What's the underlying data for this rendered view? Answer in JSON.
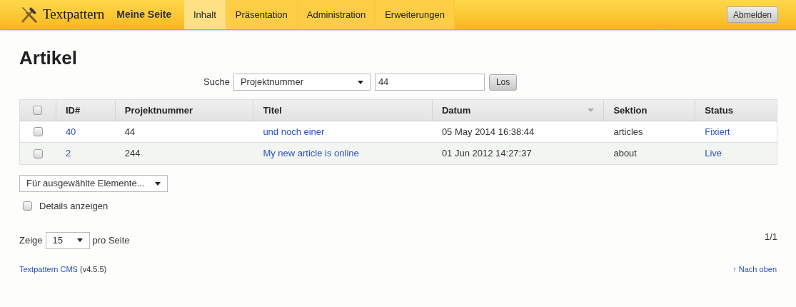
{
  "header": {
    "brand": "Textpattern",
    "site": "Meine Seite",
    "tabs": [
      {
        "label": "Inhalt",
        "selected": true
      },
      {
        "label": "Präsentation",
        "selected": false
      },
      {
        "label": "Administration",
        "selected": false
      },
      {
        "label": "Erweiterungen",
        "selected": false
      }
    ],
    "logout": "Abmelden"
  },
  "page_title": "Artikel",
  "search": {
    "label": "Suche",
    "field": "Projektnummer",
    "value": "44",
    "button": "Los"
  },
  "table": {
    "select_all": {
      "checked": false
    },
    "columns": [
      {
        "label": "ID#",
        "sorted": false
      },
      {
        "label": "Projektnummer",
        "sorted": false
      },
      {
        "label": "Titel",
        "sorted": false
      },
      {
        "label": "Datum",
        "sorted": true
      },
      {
        "label": "Sektion",
        "sorted": false
      },
      {
        "label": "Status",
        "sorted": false
      }
    ],
    "rows": [
      {
        "checked": false,
        "id": "40",
        "project": "44",
        "title": "und noch einer",
        "date": "05 May 2014 16:38:44",
        "section": "articles",
        "status": "Fixiert"
      },
      {
        "checked": false,
        "id": "2",
        "project": "244",
        "title": "My new article is online",
        "date": "01 Jun 2012 14:27:37",
        "section": "about",
        "status": "Live"
      }
    ]
  },
  "bulk_action": "Für ausgewählte Elemente...",
  "details": {
    "label": "Details anzeigen",
    "checked": false
  },
  "paging": {
    "before": "Zeige",
    "value": "15",
    "after": "pro Seite",
    "pages": "1/1"
  },
  "footer": {
    "link": "Textpattern CMS",
    "version": "(v4.5.5)",
    "top": "↑ Nach oben"
  }
}
